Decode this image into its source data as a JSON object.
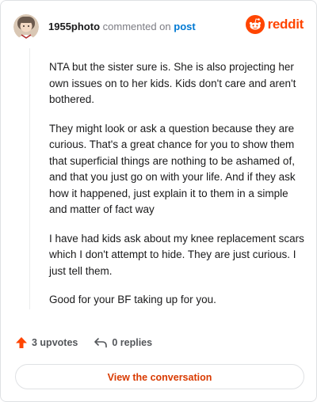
{
  "comment": {
    "username": "1955photo",
    "commented_on": "commented on",
    "post_link": "post",
    "body": [
      "NTA but the sister sure is. She is also projecting her own issues on to her kids. Kids don't care and aren't bothered.",
      "They might look or ask a question because they are curious. That's a great chance for you to show them that superficial things are nothing to be ashamed of, and that you just go on with your life. And if they ask how it happened, just explain it to them in a simple and matter of fact way",
      "I have had kids ask about my knee replacement scars which I don't attempt to hide. They are just curious. I just tell them.",
      "Good for your BF taking up for you."
    ]
  },
  "brand": {
    "name": "reddit",
    "color": "#ff4500"
  },
  "actions": {
    "upvotes": "3 upvotes",
    "replies": "0 replies",
    "upvote_icon": "upvote-arrow-icon",
    "reply_icon": "reply-arrow-icon"
  },
  "cta": {
    "label": "View the conversation"
  }
}
